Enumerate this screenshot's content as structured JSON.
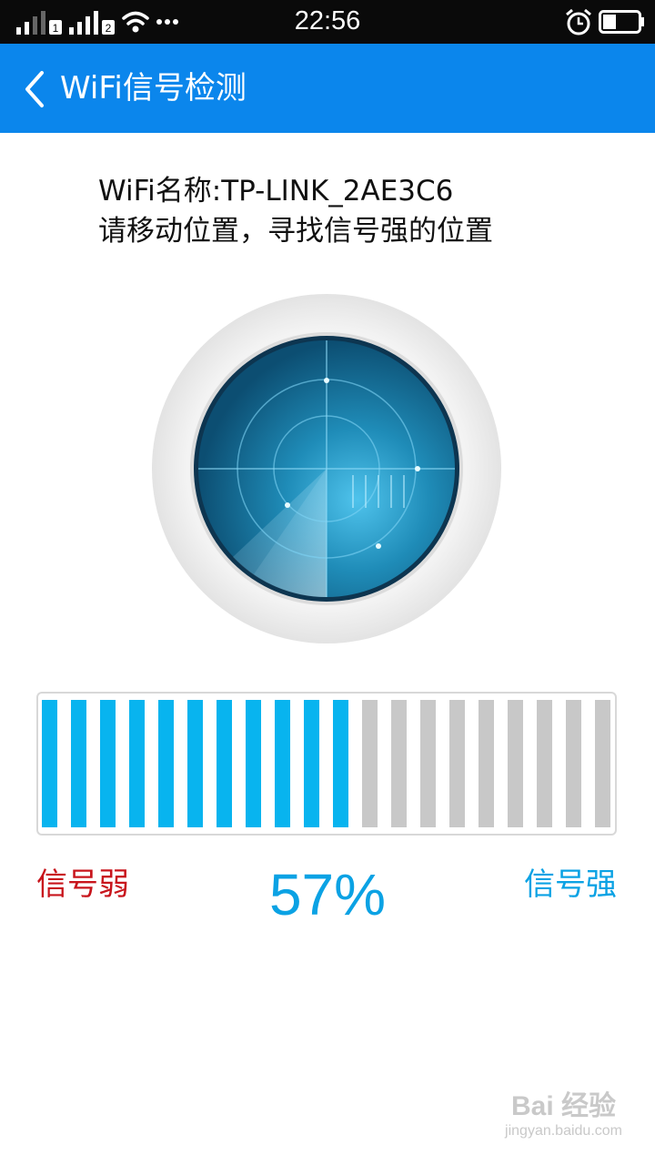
{
  "status_bar": {
    "time": "22:56",
    "sim1": "1",
    "sim2": "2",
    "more_icon": "more-dots-icon",
    "alarm_icon": "alarm-clock-icon",
    "battery_icon": "battery-icon",
    "wifi_icon": "wifi-icon"
  },
  "header": {
    "title": "WiFi信号检测",
    "back_icon": "chevron-left-icon",
    "background": "#0b86ec"
  },
  "info": {
    "wifi_name": "WiFi名称:TP-LINK_2AE3C6",
    "hint": "请移动位置，寻找信号强的位置"
  },
  "radar_icon": "radar-icon",
  "signal": {
    "total_bars": 20,
    "active_bars": 11,
    "active_color": "#08b4ef",
    "inactive_color": "#c8c8c8",
    "weak_label": "信号弱",
    "strong_label": "信号强",
    "percent": "57%"
  },
  "watermark": {
    "main": "Bai 经验",
    "sub": "jingyan.baidu.com"
  }
}
